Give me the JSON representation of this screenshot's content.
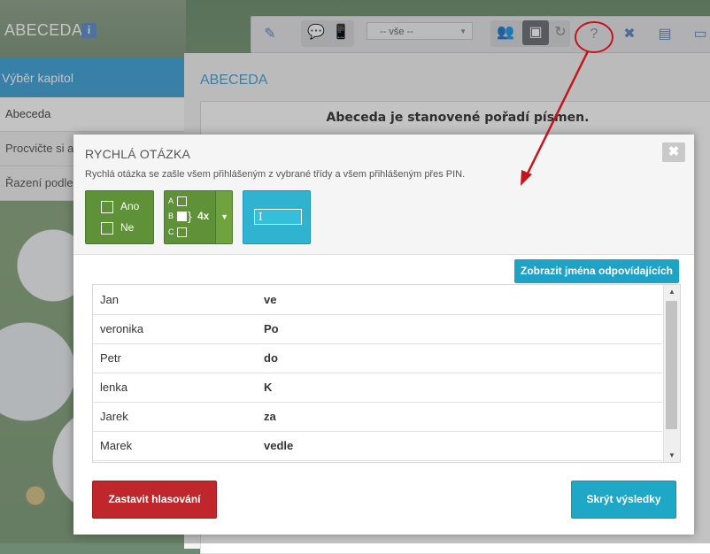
{
  "app": {
    "title": "ABECEDA",
    "info_badge": "i"
  },
  "toolbar": {
    "filter_select": "-- vše --",
    "help_label": "?"
  },
  "sidebar": {
    "header": "Výběr kapitol",
    "items": [
      {
        "label": "Abeceda"
      },
      {
        "label": "Procvičte si a"
      },
      {
        "label": "Řazení podle"
      }
    ]
  },
  "main": {
    "title": "ABECEDA",
    "heading": "Abeceda je stanovené pořadí písmen."
  },
  "modal": {
    "title": "RYCHLÁ OTÁZKA",
    "subtitle": "Rychlá otázka se zašle všem přihlášeným z vybrané třídy a všem přihlášeným přes PIN.",
    "close_label": "✖",
    "options": {
      "yes": "Ano",
      "no": "Ne",
      "abc_letters": [
        "A",
        "B",
        "C"
      ],
      "abc_count": "4x"
    },
    "show_names_button": "Zobrazit jména odpovídajících",
    "responses": [
      {
        "name": "Jan",
        "answer": "ve"
      },
      {
        "name": "veronika",
        "answer": "Po"
      },
      {
        "name": "Petr",
        "answer": "do"
      },
      {
        "name": "lenka",
        "answer": "K"
      },
      {
        "name": "Jarek",
        "answer": "za"
      },
      {
        "name": "Marek",
        "answer": "vedle"
      }
    ],
    "stop_button": "Zastavit hlasování",
    "hide_button": "Skrýt výsledky"
  },
  "colors": {
    "accent_blue": "#3fa3d9",
    "green": "#5e9138",
    "cyan": "#2fb3d1",
    "red": "#c0272d",
    "annotation": "#c3161c"
  }
}
